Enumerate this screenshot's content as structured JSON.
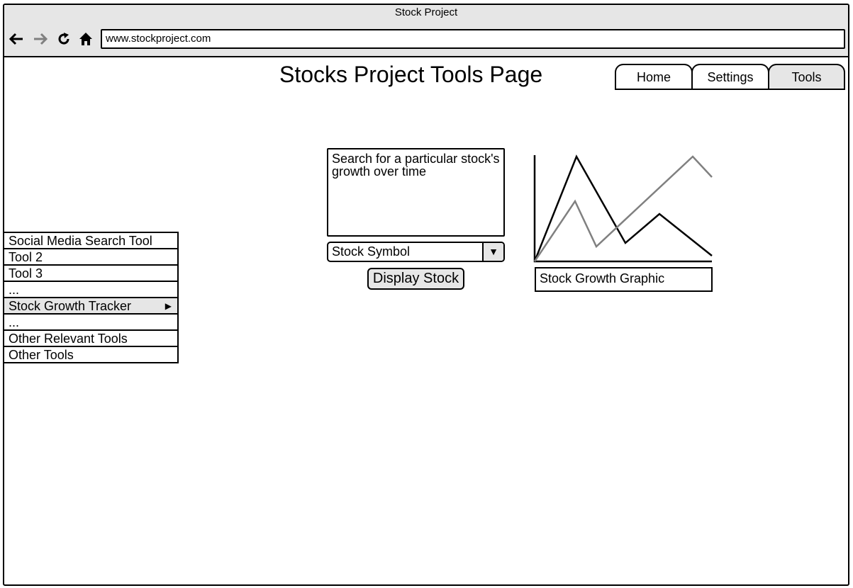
{
  "window": {
    "title": "Stock Project"
  },
  "browser": {
    "url": "www.stockproject.com"
  },
  "page": {
    "title": "Stocks Project Tools Page"
  },
  "tabs": [
    {
      "label": "Home",
      "active": false
    },
    {
      "label": "Settings",
      "active": false
    },
    {
      "label": "Tools",
      "active": true
    }
  ],
  "menu": {
    "items": [
      {
        "label": "Social Media Search Tool"
      },
      {
        "label": "Tool 2"
      },
      {
        "label": "Tool 3"
      },
      {
        "label": "..."
      },
      {
        "label": "Stock Growth Tracker",
        "selected": true,
        "submenu": true
      },
      {
        "label": "..."
      },
      {
        "label": "Other Relevant Tools"
      },
      {
        "label": "Other Tools"
      }
    ]
  },
  "search": {
    "description": "Search for a particular stock's growth over time",
    "symbol_select": "Stock Symbol",
    "button": "Display Stock"
  },
  "graphic": {
    "caption": "Stock Growth Graphic"
  },
  "colors": {
    "chrome": "#e6e6e6",
    "line_primary": "#000000",
    "line_secondary": "#808080"
  },
  "icons": [
    "back-arrow-icon",
    "forward-arrow-icon",
    "reload-icon",
    "home-icon",
    "dropdown-arrow-icon",
    "submenu-arrow-icon"
  ]
}
